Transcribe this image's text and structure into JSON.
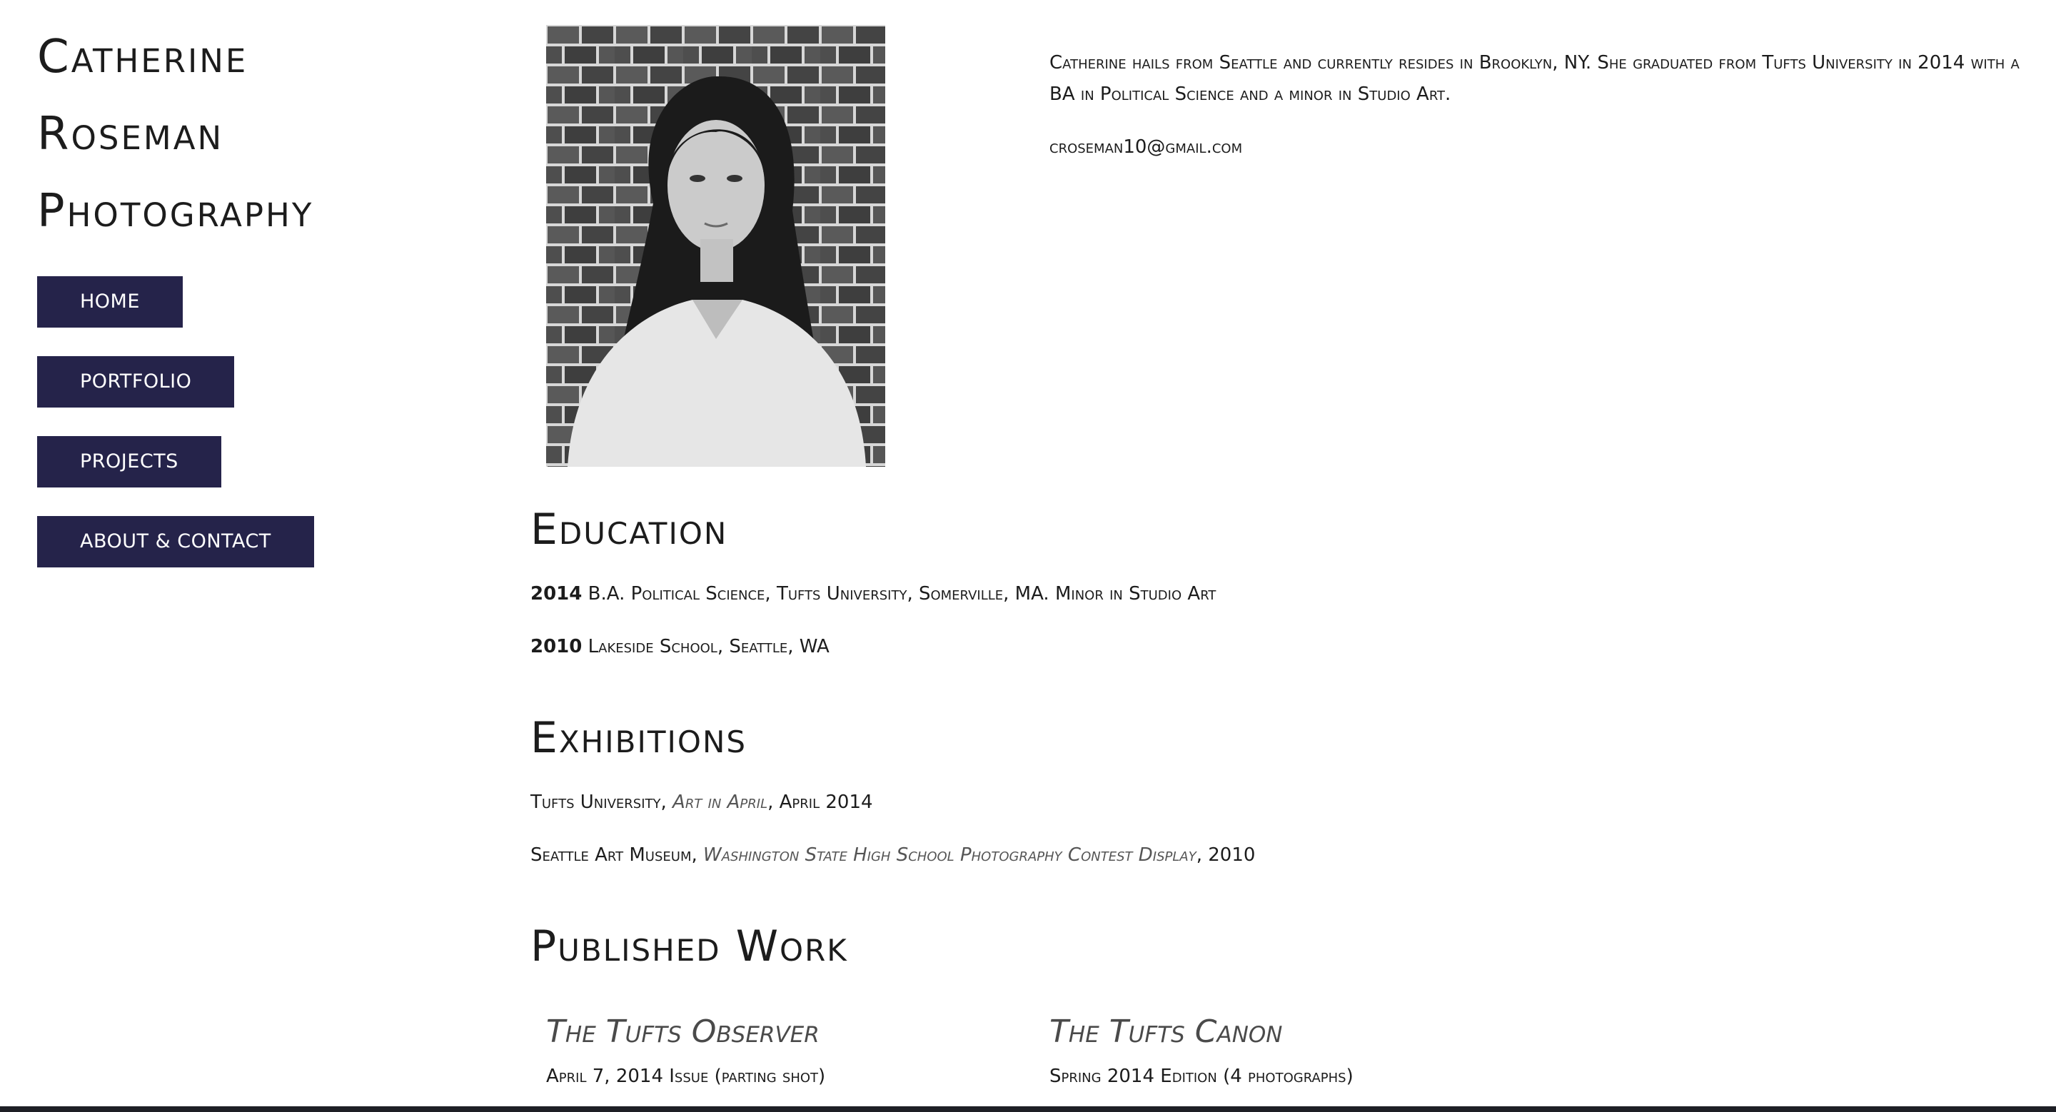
{
  "site": {
    "title_lines": [
      "Catherine",
      "Roseman",
      "Photography"
    ]
  },
  "nav": {
    "items": [
      {
        "label": "HOME"
      },
      {
        "label": "PORTFOLIO"
      },
      {
        "label": "PROJECTS"
      },
      {
        "label": "ABOUT & CONTACT"
      }
    ]
  },
  "about": {
    "bio": "Catherine hails from Seattle and currently resides in Brooklyn, NY. She graduated from Tufts University in 2014 with a BA in Political Science and a minor in Studio Art.",
    "email": "croseman10@gmail.com"
  },
  "education": {
    "heading": "Education",
    "entries": [
      {
        "year": "2014",
        "text": "B.A. Political Science, Tufts University, Somerville, MA. Minor in Studio Art"
      },
      {
        "year": "2010",
        "text": "Lakeside School, Seattle, WA"
      }
    ]
  },
  "exhibitions": {
    "heading": "Exhibitions",
    "entries": [
      {
        "venue": "Tufts University,",
        "show": "Art in April",
        "date": ", April 2014"
      },
      {
        "venue": "Seattle Art Museum,",
        "show": "Washington State High School Photography Contest Display",
        "date": ", 2010"
      }
    ]
  },
  "published": {
    "heading": "Published Work",
    "items": [
      {
        "title": "The Tufts Observer",
        "detail": "April 7, 2014 Issue (parting shot)"
      },
      {
        "title": "The Tufts Canon",
        "detail": "Spring 2014 Edition (4 photographs)"
      }
    ]
  }
}
